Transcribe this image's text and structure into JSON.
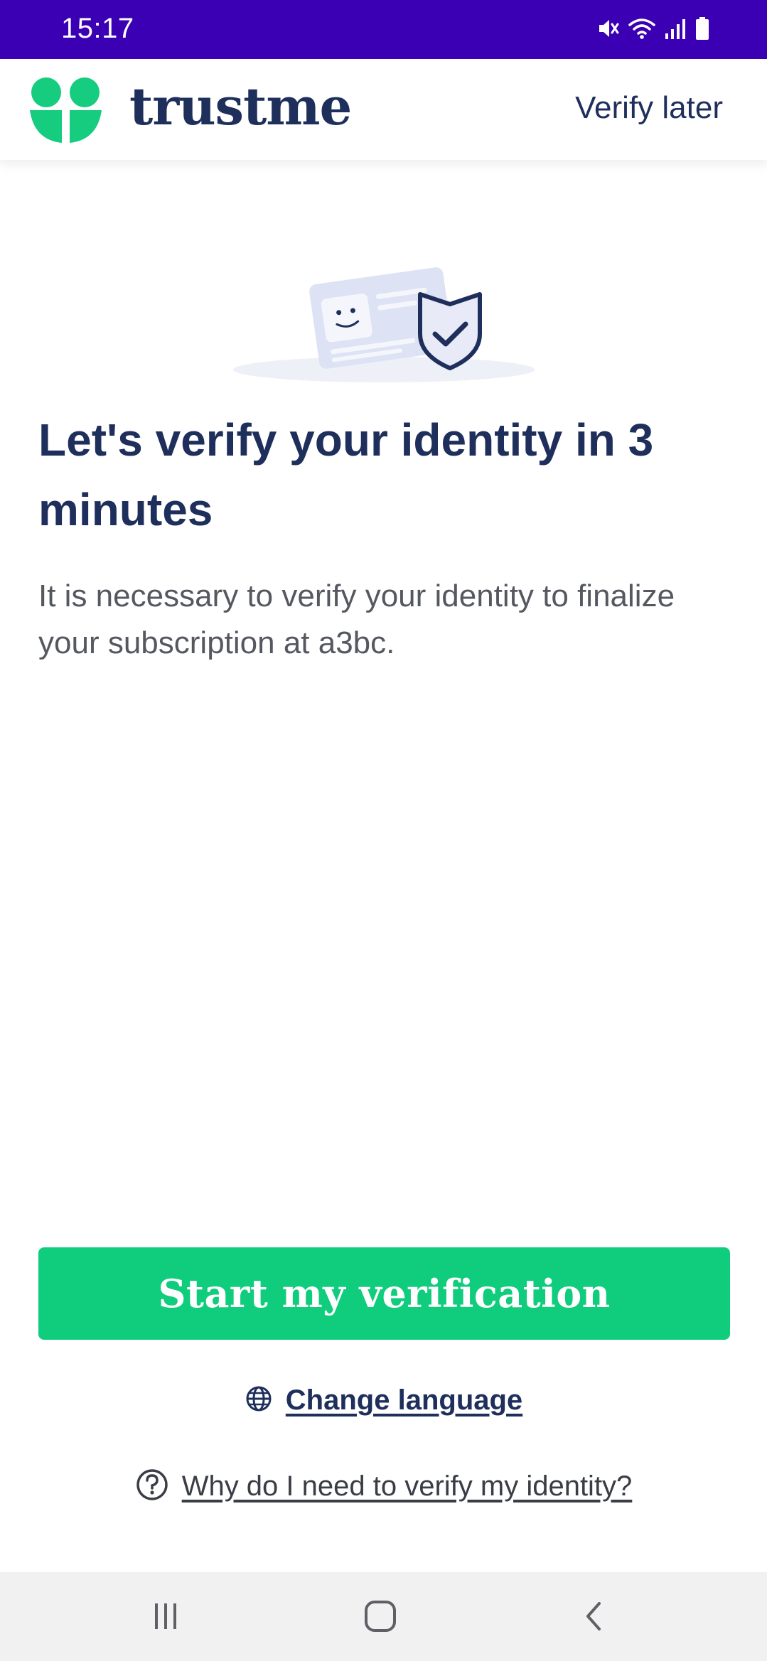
{
  "status_bar": {
    "time": "15:17",
    "color": "#3b00b3",
    "icons": [
      "mute-icon",
      "wifi-icon",
      "signal-icon",
      "battery-icon"
    ]
  },
  "header": {
    "brand": "trustme",
    "verify_later": "Verify later",
    "logo_color": "#16cc7e",
    "brand_color": "#1f2f5c"
  },
  "main": {
    "illustration_icons": [
      "id-card-icon",
      "shield-check-icon"
    ],
    "title": "Let's verify your identity in 3 minutes",
    "subtitle": "It is necessary to verify your identity to finalize your subscription at a3bc."
  },
  "actions": {
    "start_label": "Start my verification",
    "start_color": "#10cc7d",
    "change_language": "Change language",
    "why_verify": "Why do I need to verify my identity?"
  },
  "nav_bar": {
    "icons": [
      "recent-apps-icon",
      "home-icon",
      "back-icon"
    ]
  }
}
